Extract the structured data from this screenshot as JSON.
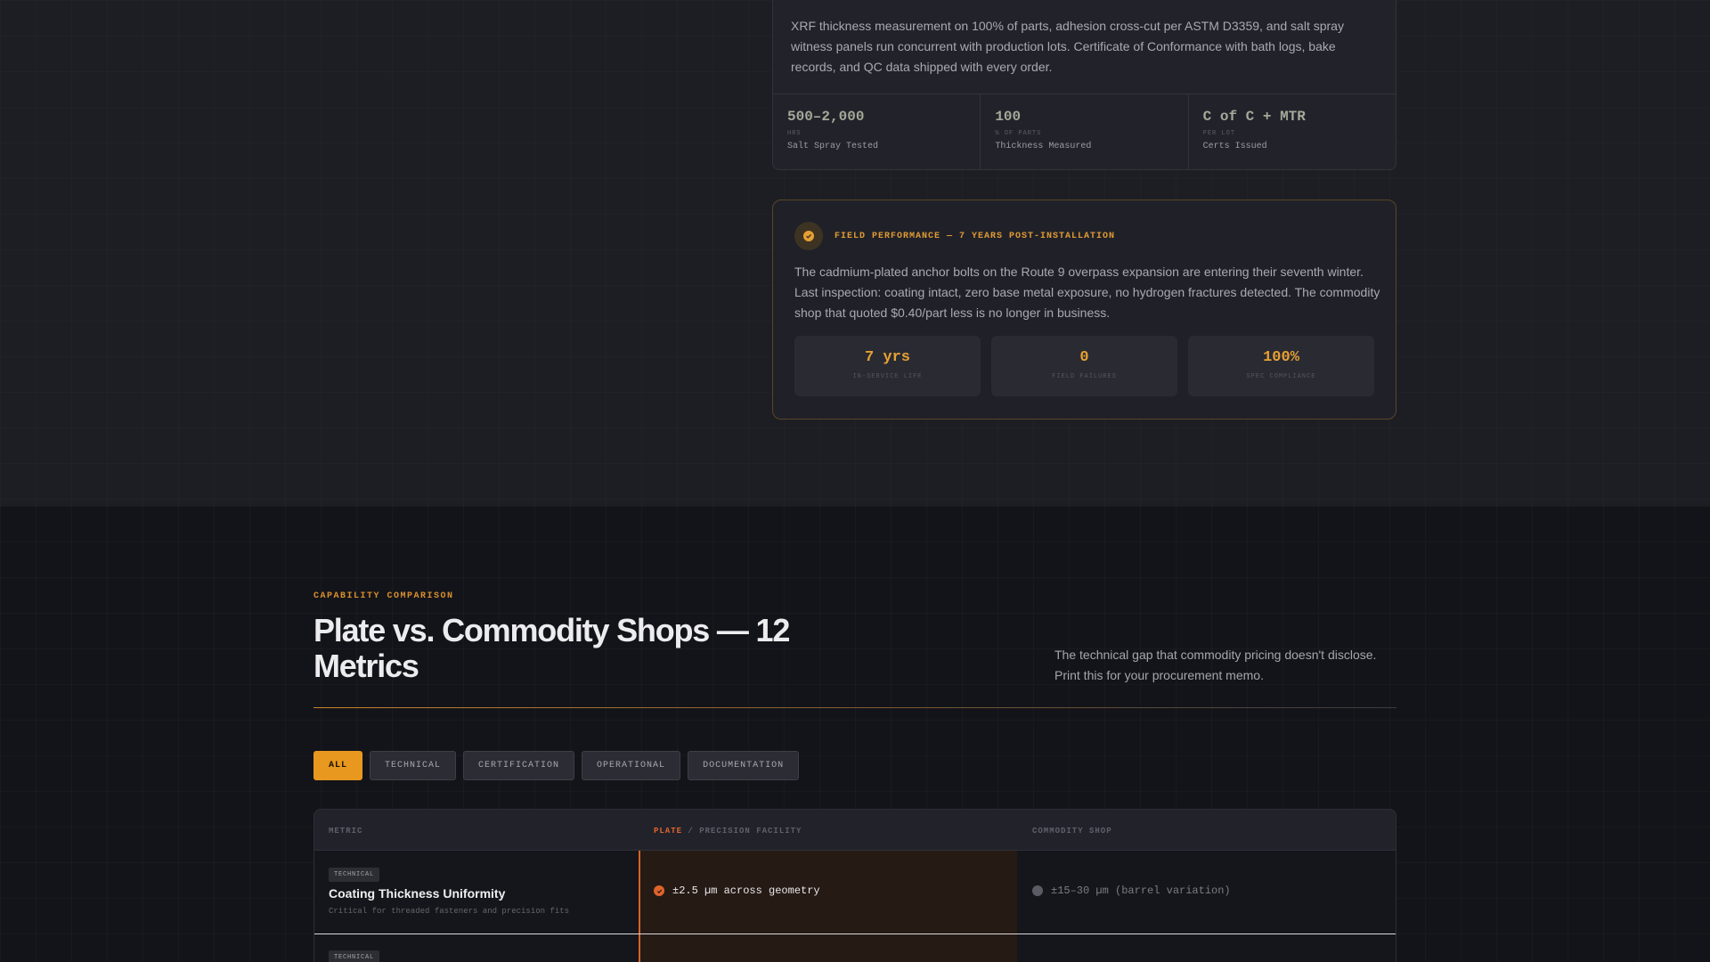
{
  "qc_card": {
    "text": "XRF thickness measurement on 100% of parts, adhesion cross-cut per ASTM D3359, and salt spray witness panels run concurrent with production lots. Certificate of Conformance with bath logs, bake records, and QC data shipped with every order.",
    "stats": [
      {
        "value": "500–2,000",
        "unit": "HRS",
        "label": "Salt Spray Tested"
      },
      {
        "value": "100",
        "unit": "% OF PARTS",
        "label": "Thickness Measured"
      },
      {
        "value": "C of C + MTR",
        "unit": "PER LOT",
        "label": "Certs Issued"
      }
    ]
  },
  "field_card": {
    "title": "FIELD PERFORMANCE — 7 YEARS POST-INSTALLATION",
    "icon": "check-circle-icon",
    "text": "The cadmium-plated anchor bolts on the Route 9 overpass expansion are entering their seventh winter. Last inspection: coating intact, zero base metal exposure, no hydrogen fractures detected. The commodity shop that quoted $0.40/part less is no longer in business.",
    "stats": [
      {
        "value": "7 yrs",
        "label": "IN-SERVICE LIFE"
      },
      {
        "value": "0",
        "label": "FIELD FAILURES"
      },
      {
        "value": "100%",
        "label": "SPEC COMPLIANCE"
      }
    ]
  },
  "comparison": {
    "eyebrow": "CAPABILITY COMPARISON",
    "title": "Plate vs. Commodity Shops — 12 Metrics",
    "description": "The technical gap that commodity pricing doesn't disclose. Print this for your procurement memo.",
    "filters": [
      "ALL",
      "TECHNICAL",
      "CERTIFICATION",
      "OPERATIONAL",
      "DOCUMENTATION"
    ],
    "active_filter": "ALL",
    "table": {
      "headers": {
        "metric": "METRIC",
        "plate_highlight": "PLATE",
        "plate_rest": " / PRECISION FACILITY",
        "shop": "COMMODITY SHOP"
      },
      "rows": [
        {
          "tag": "TECHNICAL",
          "metric": "Coating Thickness Uniformity",
          "sub": "Critical for threaded fasteners and precision fits",
          "plate": "±2.5 µm across geometry",
          "shop": "±15–30 µm (barrel variation)"
        },
        {
          "tag": "TECHNICAL"
        }
      ]
    }
  },
  "colors": {
    "accent": "#e8981f",
    "plate_accent": "#e0632c"
  }
}
